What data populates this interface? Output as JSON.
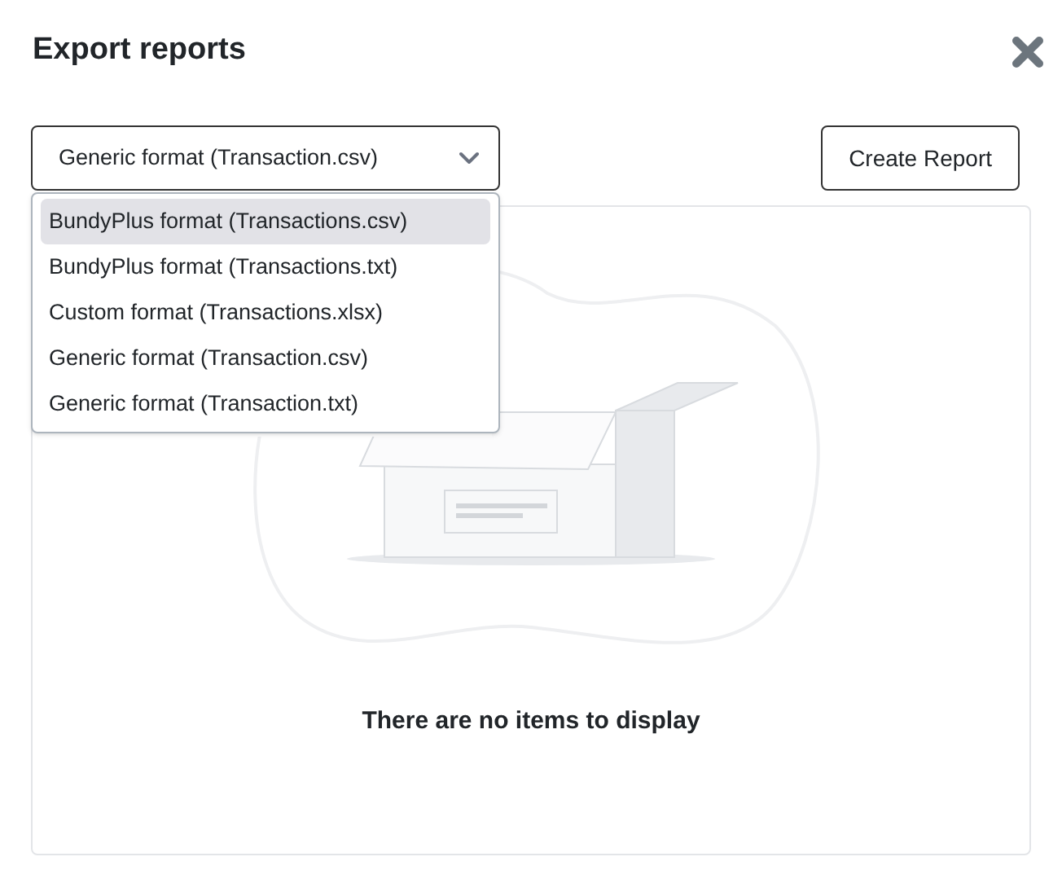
{
  "dialog": {
    "title": "Export reports"
  },
  "format_select": {
    "value": "Generic format (Transaction.csv)",
    "expanded": true,
    "options": [
      {
        "label": "BundyPlus format (Transactions.csv)",
        "highlighted": true
      },
      {
        "label": "BundyPlus format (Transactions.txt)",
        "highlighted": false
      },
      {
        "label": "Custom format (Transactions.xlsx)",
        "highlighted": false
      },
      {
        "label": "Generic format (Transaction.csv)",
        "highlighted": false
      },
      {
        "label": "Generic format (Transaction.txt)",
        "highlighted": false
      }
    ]
  },
  "create_button": "Create Report",
  "empty_state": {
    "message": "There are no items to display"
  }
}
